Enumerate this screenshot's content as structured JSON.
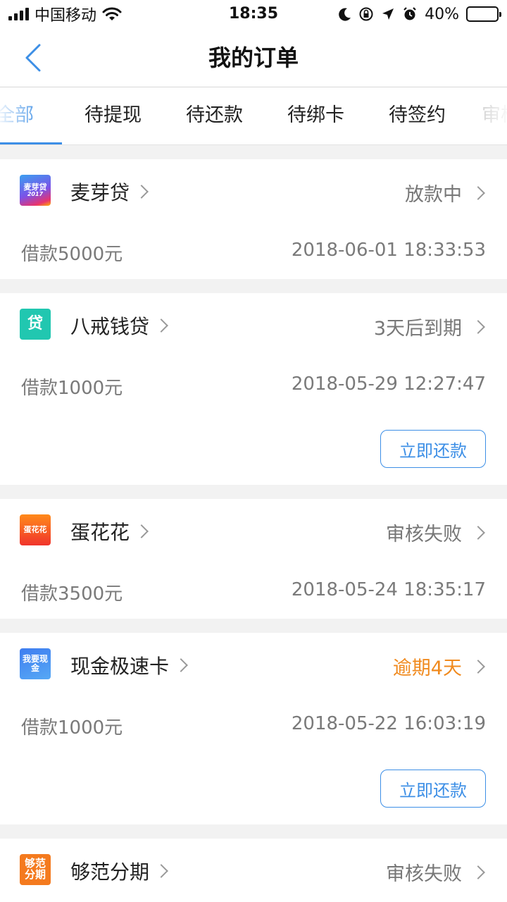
{
  "status_bar": {
    "carrier": "中国移动",
    "time": "18:35",
    "battery_percent": "40%",
    "battery_level": 0.4
  },
  "nav": {
    "title": "我的订单",
    "back_icon": "chevron-left-icon"
  },
  "tabs": [
    {
      "label": "全部",
      "active": true
    },
    {
      "label": "待提现",
      "active": false
    },
    {
      "label": "待还款",
      "active": false
    },
    {
      "label": "待绑卡",
      "active": false
    },
    {
      "label": "待签约",
      "active": false
    },
    {
      "label": "审核",
      "active": false
    }
  ],
  "colors": {
    "accent": "#3d8fe6",
    "overdue": "#f08a1e",
    "muted": "#7a7a7a"
  },
  "orders": [
    {
      "name": "麦芽贷",
      "logo_text": "麦芽贷",
      "logo_sub": "2017",
      "status": "放款中",
      "amount": "借款5000元",
      "date": "2018-06-01 18:33:53",
      "action": ""
    },
    {
      "name": "八戒钱贷",
      "logo_text": "贷",
      "status": "3天后到期",
      "amount": "借款1000元",
      "date": "2018-05-29 12:27:47",
      "action": "立即还款"
    },
    {
      "name": "蛋花花",
      "logo_text": "蛋花花",
      "status": "审核失败",
      "amount": "借款3500元",
      "date": "2018-05-24 18:35:17",
      "action": ""
    },
    {
      "name": "现金极速卡",
      "logo_text": "我要现金",
      "status": "逾期4天",
      "amount": "借款1000元",
      "date": "2018-05-22 16:03:19",
      "action": "立即还款"
    },
    {
      "name": "够范分期",
      "logo_text": "够范分期",
      "status": "审核失败",
      "amount": "",
      "date": "",
      "action": ""
    }
  ]
}
